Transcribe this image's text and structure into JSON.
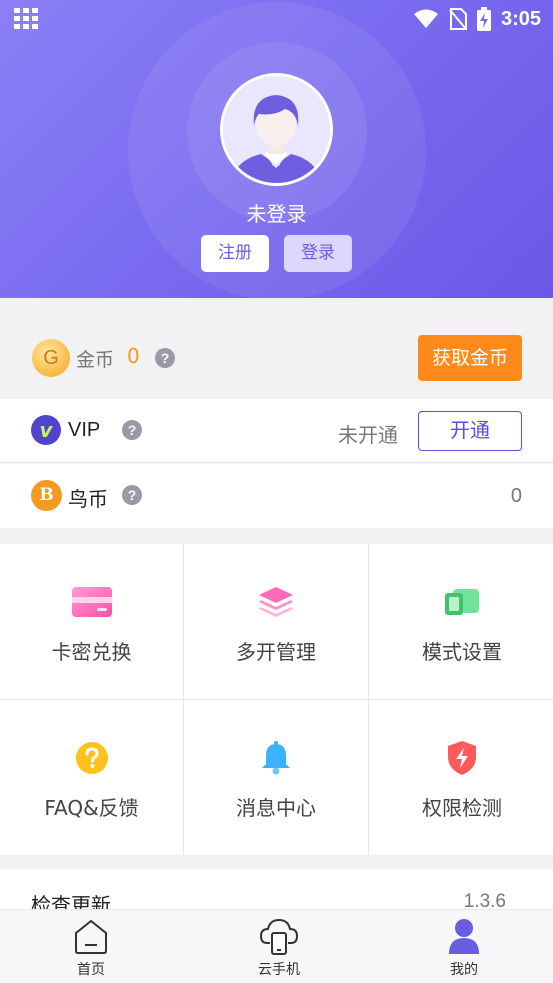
{
  "status_bar": {
    "time": "3:05"
  },
  "profile": {
    "login_state": "未登录",
    "register_label": "注册",
    "login_label": "登录"
  },
  "coins": {
    "label": "金币",
    "value": "0",
    "icon_letter": "G",
    "get_button": "获取金币"
  },
  "vip": {
    "badge": "v",
    "label": "VIP",
    "status": "未开通",
    "activate_button": "开通"
  },
  "bird_coin": {
    "badge": "B",
    "label": "鸟币",
    "value": "0"
  },
  "grid": {
    "items": [
      {
        "label": "卡密兑换",
        "icon": "card-icon"
      },
      {
        "label": "多开管理",
        "icon": "layers-icon"
      },
      {
        "label": "模式设置",
        "icon": "mode-icon"
      },
      {
        "label": "FAQ&反馈",
        "icon": "faq-icon"
      },
      {
        "label": "消息中心",
        "icon": "bell-icon"
      },
      {
        "label": "权限检测",
        "icon": "shield-icon"
      }
    ]
  },
  "update": {
    "label": "检查更新",
    "version": "1.3.6"
  },
  "bottom_nav": {
    "items": [
      {
        "label": "首页",
        "icon": "home-icon"
      },
      {
        "label": "云手机",
        "icon": "cloud-phone-icon"
      },
      {
        "label": "我的",
        "icon": "user-icon"
      }
    ]
  },
  "colors": {
    "header_gradient_start": "#8b80f6",
    "header_gradient_end": "#6b58e6",
    "accent": "#5b4de0",
    "orange": "#ff8a1c",
    "coin_value": "#f39a1d"
  },
  "help_mark": "?"
}
